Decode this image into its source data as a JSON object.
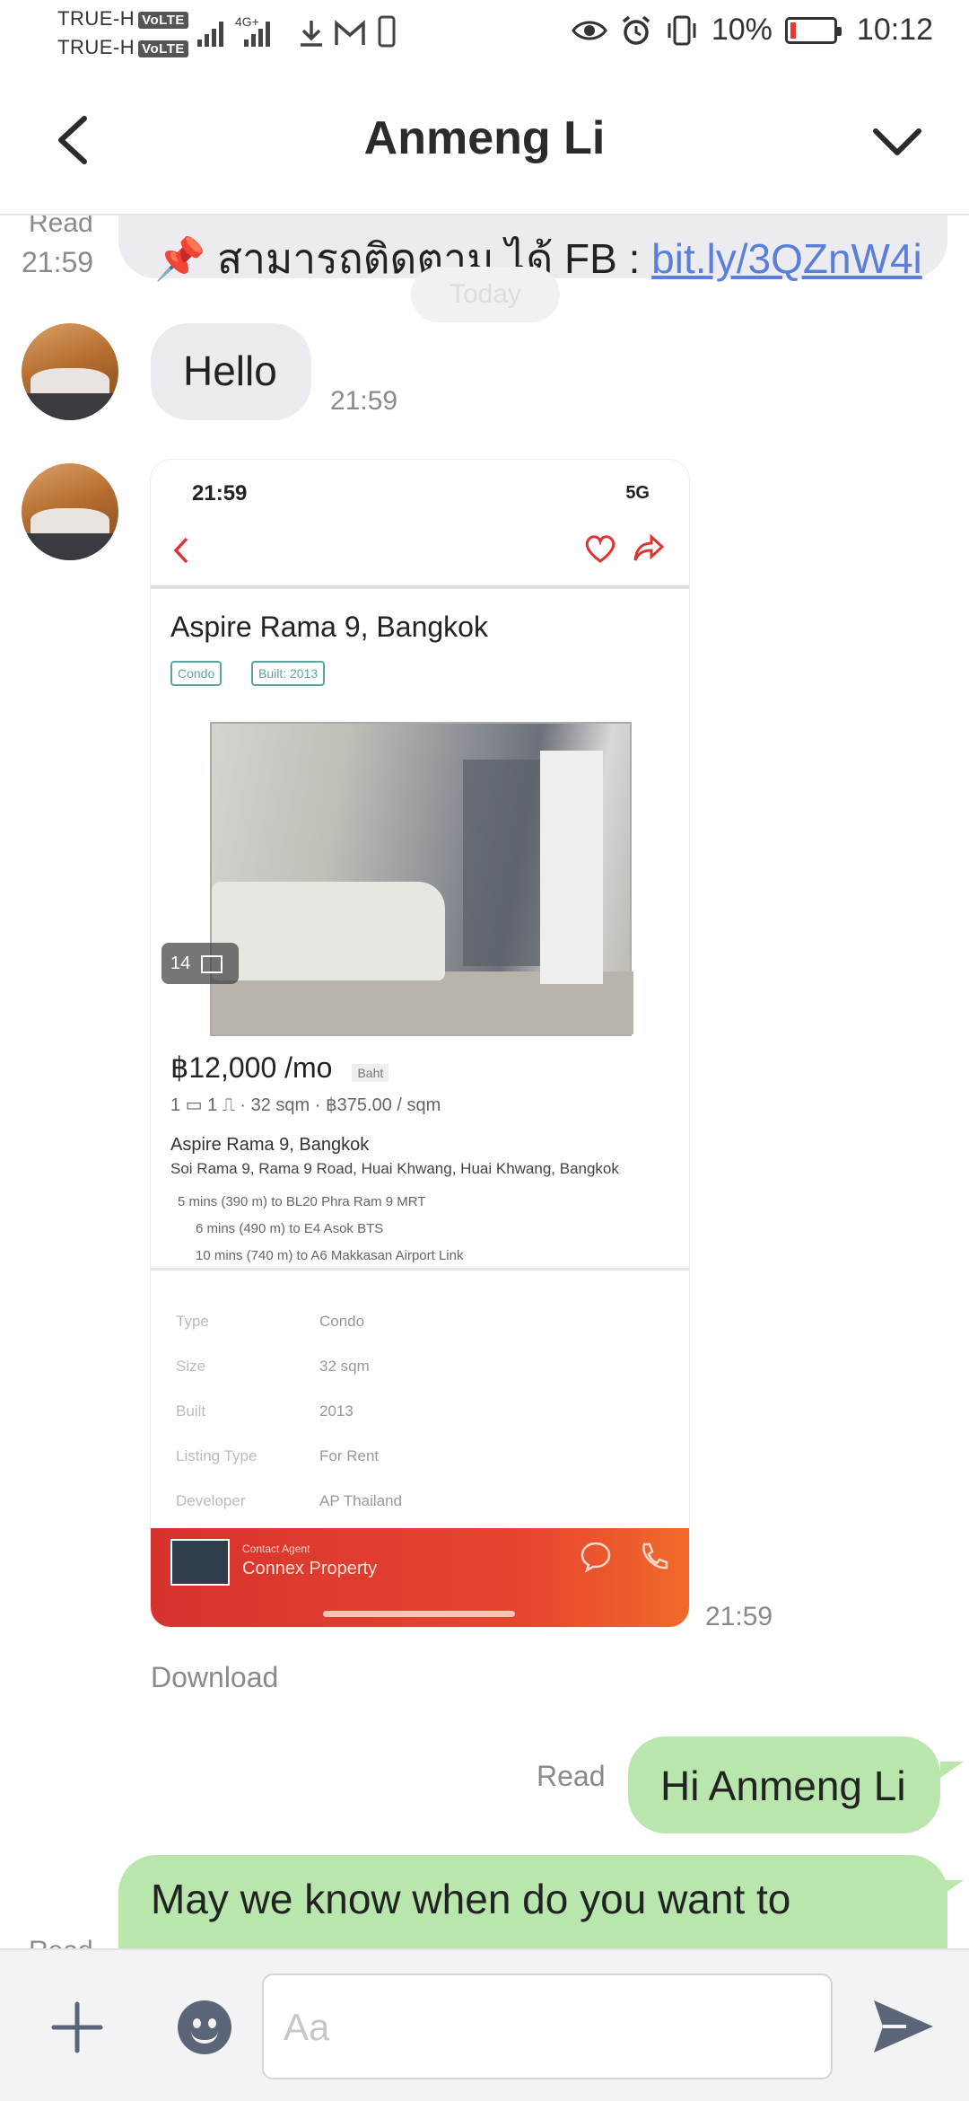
{
  "status": {
    "carrier1": "TRUE-H",
    "carrier2": "TRUE-H",
    "volte": "VoLTE",
    "net": "4G+",
    "battery": "10%",
    "time": "10:12"
  },
  "header": {
    "title": "Anmeng Li"
  },
  "messages": {
    "m0": {
      "meta_read": "Read",
      "meta_time": "21:59",
      "text": "📌 สามารถติดตาม ได้ FB : ",
      "link": "bit.ly/3QZnW4i"
    },
    "today": "Today",
    "m1": {
      "text": "Hello",
      "time": "21:59"
    },
    "m2": {
      "time": "21:59",
      "download": "Download",
      "shot": {
        "status_time": "21:59",
        "status_net": "5G",
        "title": "Aspire Rama 9, Bangkok",
        "chip1": "Condo",
        "chip2": "Built: 2013",
        "photo_count": "14",
        "price": "฿12,000 /mo",
        "price_tag": "Baht",
        "specs": "1 ▭  1 ⎍   ·   32 sqm   ·   ฿375.00 / sqm",
        "addr1": "Aspire Rama 9, Bangkok",
        "addr2": "Soi Rama 9, Rama 9 Road, Huai Khwang, Huai Khwang, Bangkok",
        "near1": "5 mins (390 m) to BL20 Phra Ram 9 MRT",
        "near2": "6 mins (490 m) to E4 Asok BTS",
        "near3": "10 mins (740 m) to A6 Makkasan Airport Link",
        "rows": [
          {
            "k": "Type",
            "v": "Condo"
          },
          {
            "k": "Size",
            "v": "32 sqm"
          },
          {
            "k": "Built",
            "v": "2013"
          },
          {
            "k": "Listing Type",
            "v": "For Rent"
          },
          {
            "k": "Developer",
            "v": "AP Thailand"
          }
        ],
        "agent_label": "Contact Agent",
        "agent_name": "Connex Property"
      }
    },
    "m3": {
      "read": "Read",
      "text": "Hi Anmeng Li"
    },
    "m4": {
      "text": "May we know when do you want to",
      "read": "Read"
    }
  },
  "input": {
    "placeholder": "Aa"
  }
}
